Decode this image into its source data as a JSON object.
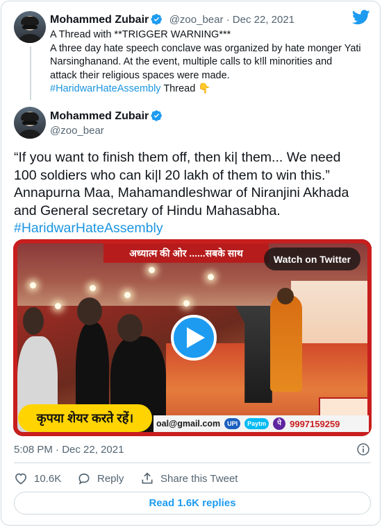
{
  "colors": {
    "link": "#1b95e0",
    "accent": "#1d9bf0",
    "text": "#0f1419",
    "muted": "#536471",
    "caption_yellow": "#ffd400"
  },
  "tweet1": {
    "author_name": "Mohammed Zubair",
    "handle_date": "@zoo_bear · Dec 22, 2021",
    "lines": [
      "A Thread with **TRIGGER WARNING***",
      "A three day hate speech conclave was organized by hate monger Yati",
      "Narsinghanand. At the event, multiple calls to k!ll minorities and",
      "attack their religious spaces were made."
    ],
    "hashtag": "#HaridwarHateAssembly",
    "suffix": " Thread ",
    "emoji": "👇"
  },
  "tweet2": {
    "author_name": "Mohammed Zubair",
    "handle": "@zoo_bear",
    "text_lines": [
      "“If you want to finish them off, then ki| them... We need",
      "100 soldiers who can ki|l 20 lakh of them to win this.”",
      "Annapurna Maa, Mahamandleshwar of Niranjini Akhada",
      "and General secretary of Hindu Mahasabha."
    ],
    "hashtag": "#HaridwarHateAssembly",
    "media": {
      "watch_label": "Watch on Twitter",
      "banner_text": "अध्यात्म की ओर ......सबके साथ",
      "caption_text": "कृपया शेयर करते रहें।",
      "email_text": "oal@gmail.com",
      "pay_label": "UPI",
      "paytm_label": "Paytm",
      "pe_label": "पे",
      "phone_text": "9997159259"
    },
    "timestamp": "5:08 PM · Dec 22, 2021",
    "likes": "10.6K",
    "reply_label": "Reply",
    "share_label": "Share this Tweet",
    "read_replies": "Read 1.6K replies"
  },
  "icons": [
    "twitter-bird-icon",
    "verified-badge-icon",
    "play-icon",
    "info-icon",
    "heart-icon",
    "reply-bubble-icon",
    "share-icon"
  ]
}
